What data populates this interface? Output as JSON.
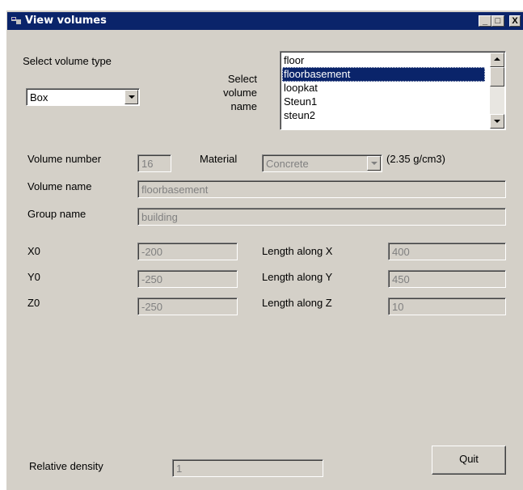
{
  "window": {
    "title": "View volumes"
  },
  "titlebar_buttons": {
    "minimize": "_",
    "maximize": "□",
    "close": "X"
  },
  "volume_type": {
    "label": "Select volume type",
    "selected": "Box"
  },
  "volume_name": {
    "label": "Select volume name",
    "items": [
      "floor",
      "floorbasement",
      "loopkat",
      "Steun1",
      "steun2"
    ],
    "selected_index": 1
  },
  "fields": {
    "volume_number": {
      "label": "Volume number",
      "value": "16"
    },
    "material": {
      "label": "Material",
      "value": "Concrete",
      "density_note": "(2.35 g/cm3)"
    },
    "volume_name": {
      "label": "Volume name",
      "value": "floorbasement"
    },
    "group_name": {
      "label": "Group name",
      "value": "building"
    },
    "x0": {
      "label": "X0",
      "value": "-200"
    },
    "y0": {
      "label": "Y0",
      "value": "-250"
    },
    "z0": {
      "label": "Z0",
      "value": "-250"
    },
    "length_x": {
      "label": "Length along X",
      "value": "400"
    },
    "length_y": {
      "label": "Length along Y",
      "value": "450"
    },
    "length_z": {
      "label": "Length along Z",
      "value": "10"
    },
    "relative_density": {
      "label": "Relative density",
      "value": "1"
    }
  },
  "quit_button": {
    "label": "Quit"
  },
  "colors": {
    "titlebar": "#0a246a",
    "face": "#d4d0c8",
    "disabled_text": "#808080"
  }
}
